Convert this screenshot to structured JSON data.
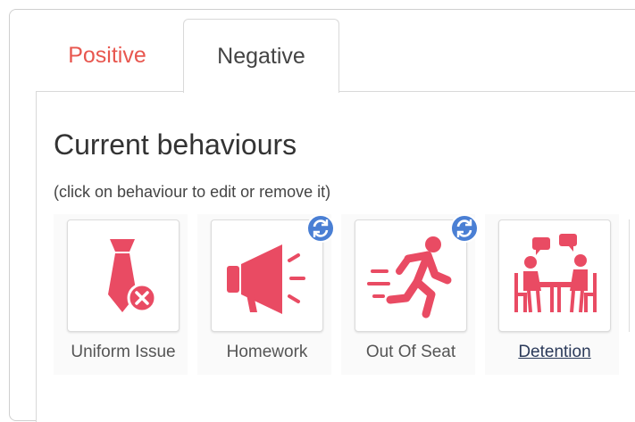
{
  "tabs": {
    "positive": "Positive",
    "negative": "Negative",
    "active": "Negative"
  },
  "panel": {
    "title": "Current behaviours",
    "hint": "(click on behaviour to edit or remove it)"
  },
  "behaviours": [
    {
      "label": "Uniform Issue",
      "icon": "tie-remove-icon",
      "synced": false,
      "linked": false
    },
    {
      "label": "Homework",
      "icon": "megaphone-icon",
      "synced": true,
      "linked": false
    },
    {
      "label": "Out Of Seat",
      "icon": "running-person-icon",
      "synced": true,
      "linked": false
    },
    {
      "label": "Detention",
      "icon": "meeting-table-icon",
      "synced": false,
      "linked": true
    }
  ],
  "colors": {
    "icon": "#e94b63",
    "positive_tab": "#e8574f",
    "sync_badge": "#4a7fd4"
  }
}
